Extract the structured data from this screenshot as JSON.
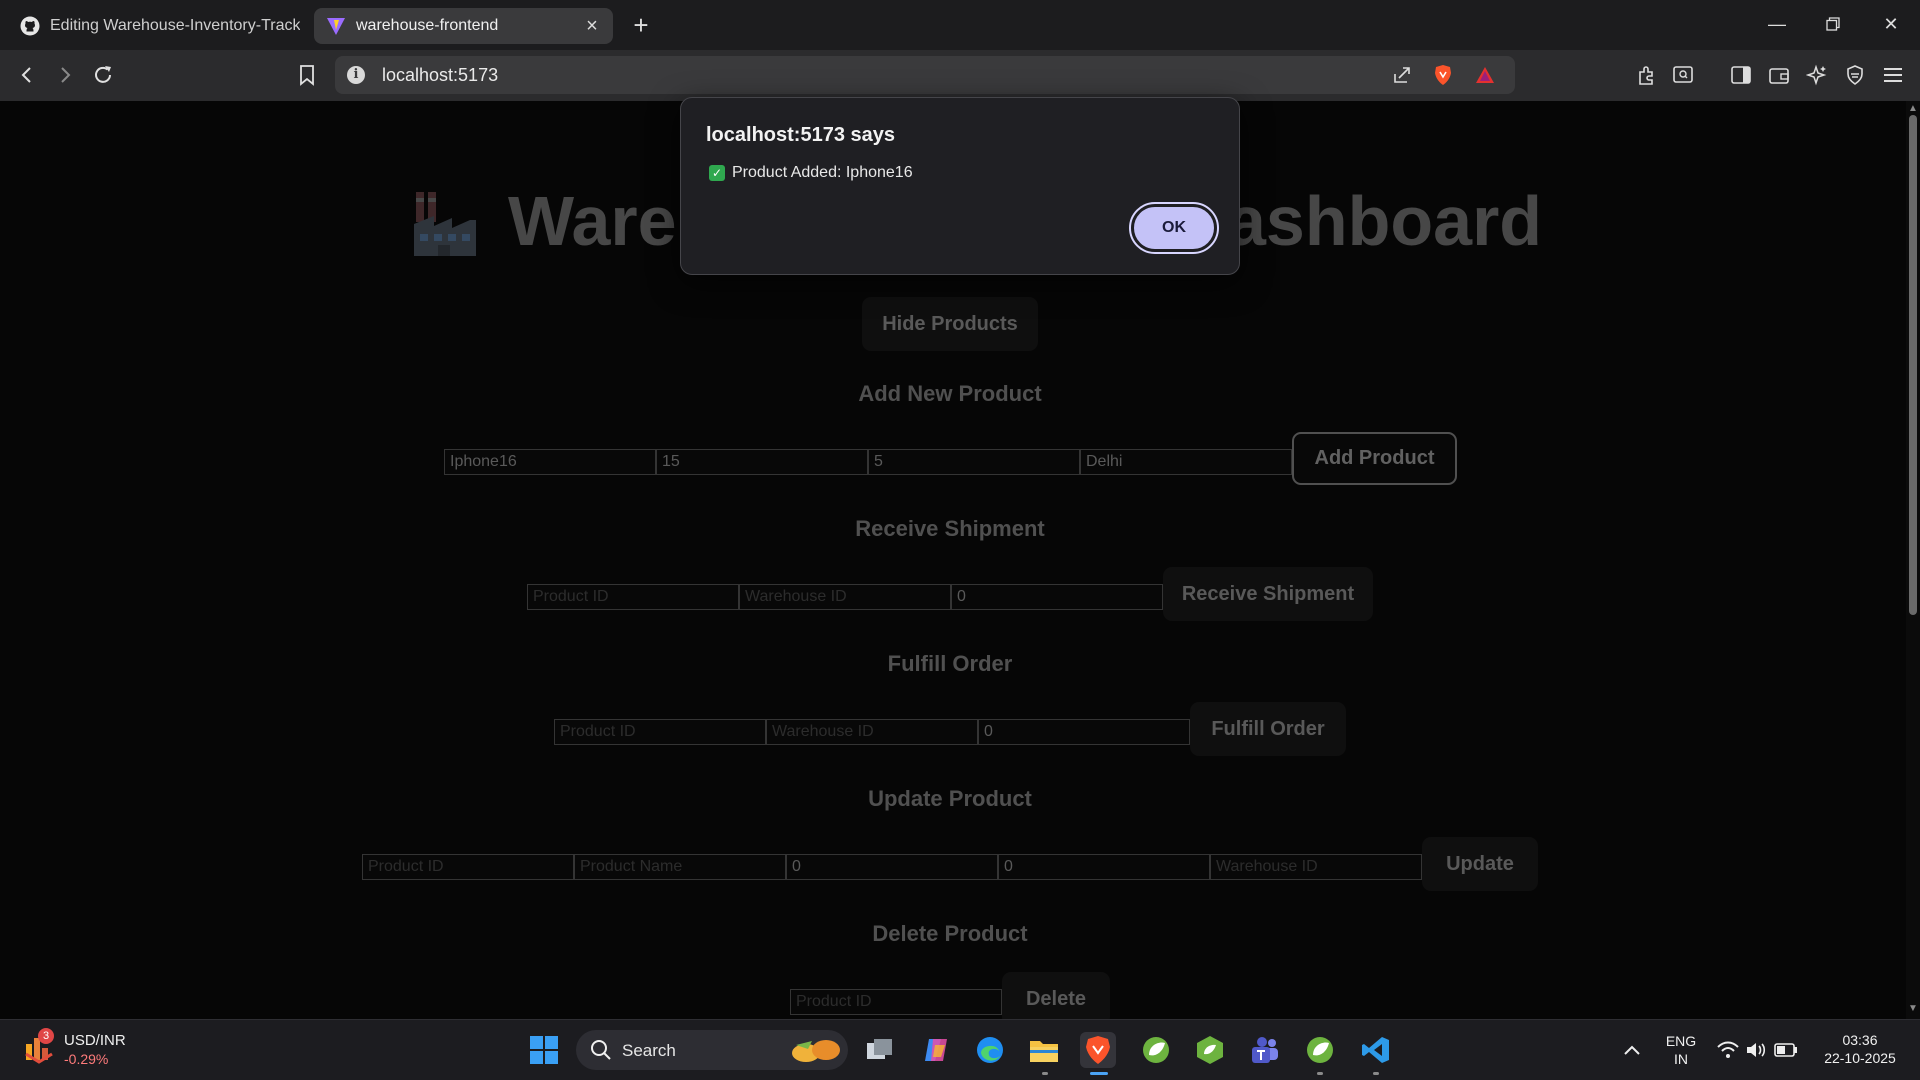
{
  "browser": {
    "tabs": [
      {
        "title": "Editing Warehouse-Inventory-Tracker",
        "icon": "github-icon",
        "active": false
      },
      {
        "title": "warehouse-frontend",
        "icon": "vite-icon",
        "active": true
      }
    ],
    "url": "localhost:5173"
  },
  "page": {
    "title": "Warehouse Inventory Dashboard",
    "title_left": "Wareh",
    "title_right": "ashboard",
    "hide_products_label": "Hide Products",
    "add_product": {
      "heading": "Add New Product",
      "name_value": "Iphone16",
      "price_value": "15",
      "quantity_value": "5",
      "warehouse_value": "Delhi",
      "button": "Add Product"
    },
    "receive_shipment": {
      "heading": "Receive Shipment",
      "product_id_placeholder": "Product ID",
      "warehouse_id_placeholder": "Warehouse ID",
      "quantity_value": "0",
      "button": "Receive Shipment"
    },
    "fulfill_order": {
      "heading": "Fulfill Order",
      "product_id_placeholder": "Product ID",
      "warehouse_id_placeholder": "Warehouse ID",
      "quantity_value": "0",
      "button": "Fulfill Order"
    },
    "update_product": {
      "heading": "Update Product",
      "product_id_placeholder": "Product ID",
      "product_name_placeholder": "Product Name",
      "price_value": "0",
      "quantity_value": "0",
      "warehouse_id_placeholder": "Warehouse ID",
      "button": "Update"
    },
    "delete_product": {
      "heading": "Delete Product",
      "product_id_placeholder": "Product ID",
      "button": "Delete"
    }
  },
  "dialog": {
    "title": "localhost:5173 says",
    "message": "Product Added: Iphone16",
    "ok_label": "OK"
  },
  "taskbar": {
    "stock_symbol": "USD/INR",
    "stock_change": "-0.29%",
    "stock_badge": "3",
    "search_label": "Search",
    "lang_top": "ENG",
    "lang_bottom": "IN",
    "time": "03:36",
    "date": "22-10-2025"
  },
  "colors": {
    "dialog_ok": "#c4c2f7",
    "check_green": "#2fa84f",
    "stock_negative": "#ff7b7b"
  }
}
